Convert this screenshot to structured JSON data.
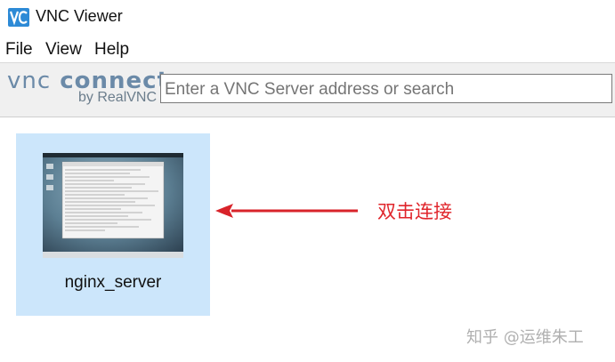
{
  "window": {
    "title": "VNC Viewer"
  },
  "menu": [
    {
      "label": "File"
    },
    {
      "label": "View"
    },
    {
      "label": "Help"
    }
  ],
  "logo": {
    "vnc": "vnc",
    "connect": "connect",
    "by": "by RealVNC"
  },
  "search": {
    "placeholder": "Enter a VNC Server address or search"
  },
  "connections": [
    {
      "label": "nginx_server"
    }
  ],
  "annotation": {
    "text": "双击连接",
    "color": "#e0252b"
  },
  "watermark": {
    "text": "知乎 @运维朱工"
  },
  "colors": {
    "tile_selected": "#cce6fb",
    "toolbar": "#f0f0f0",
    "logo": "#6b8aa8"
  }
}
